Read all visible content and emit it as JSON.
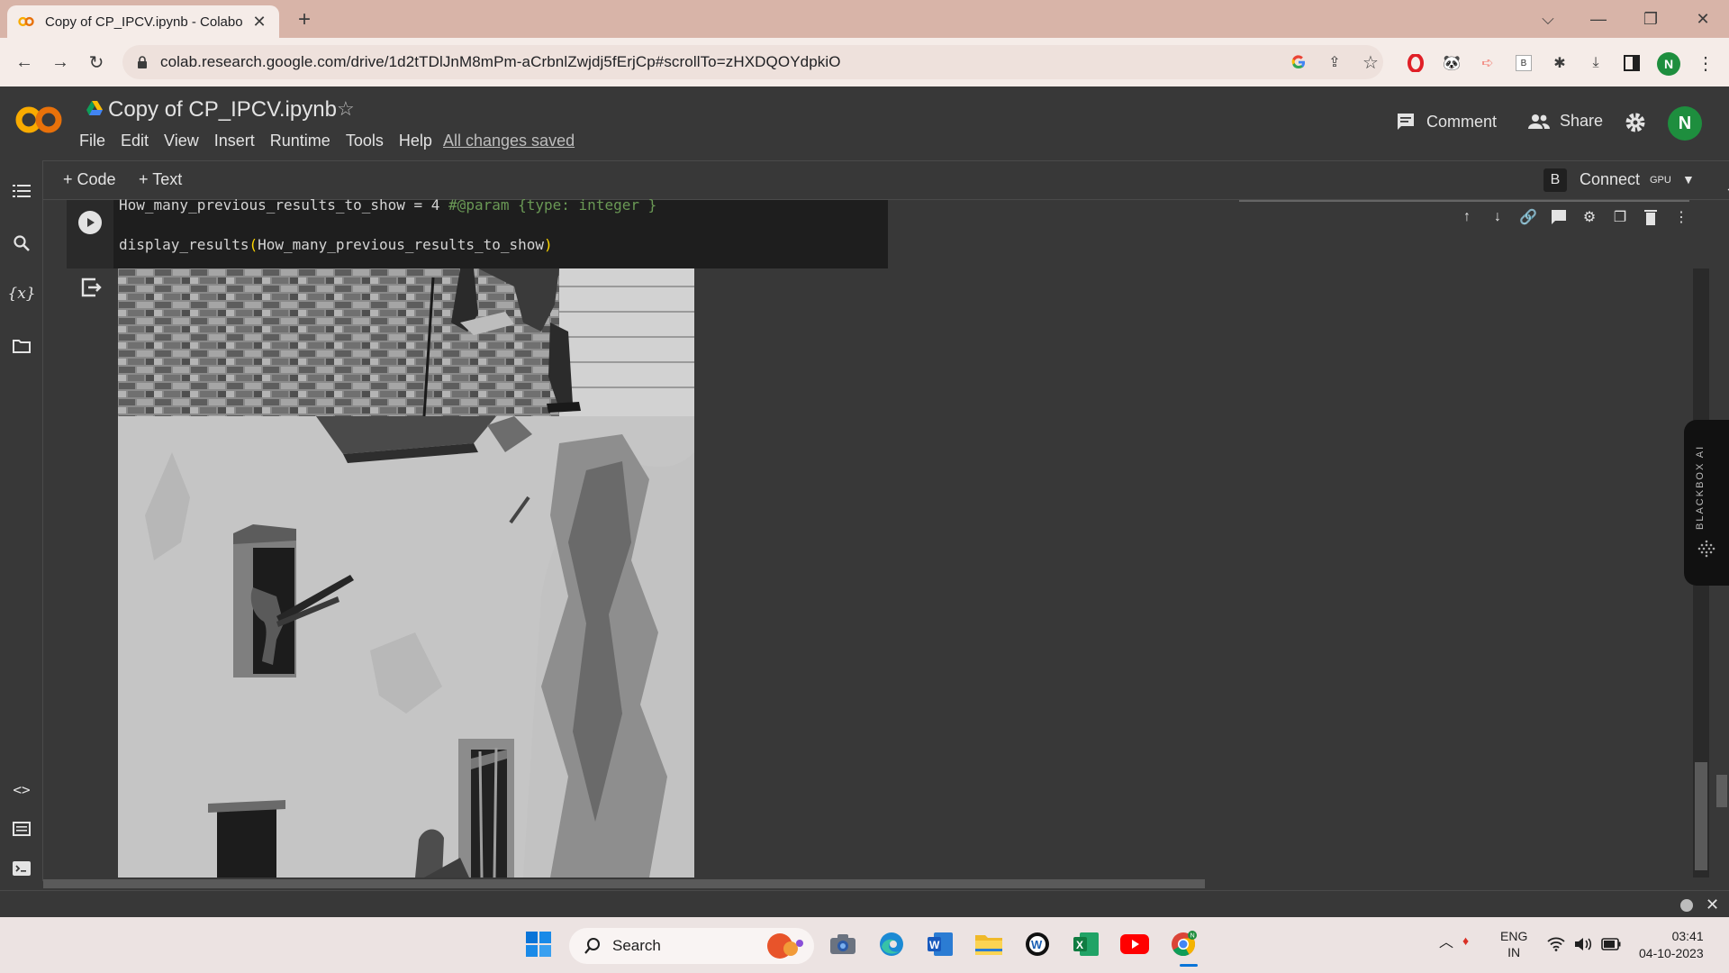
{
  "browser": {
    "tab_title": "Copy of CP_IPCV.ipynb - Colabo",
    "url": "colab.research.google.com/drive/1d2tTDlJnM8mPm-aCrbnlZwjdj5fErjCp#scrollTo=zHXDQOYdpkiO",
    "profile_initial": "N"
  },
  "colab": {
    "notebook_title": "Copy of CP_IPCV.ipynb",
    "menu": [
      "File",
      "Edit",
      "View",
      "Insert",
      "Runtime",
      "Tools",
      "Help"
    ],
    "save_status": "All changes saved",
    "comment_label": "Comment",
    "share_label": "Share",
    "user_initial": "N",
    "add_code_label": "+ Code",
    "add_text_label": "+ Text",
    "runtime_badge": "B",
    "connect_label": "Connect",
    "gpu_label": "GPU"
  },
  "cell": {
    "line1_code": "How_many_previous_results_to_show = 4 ",
    "line1_comment": "#@param {type: integer }",
    "line2_func": "display_results",
    "line2_open": "(",
    "line2_arg": "How_many_previous_results_to_show",
    "line2_close": ")"
  },
  "side_panel": {
    "label": "BLACKBOX AI"
  },
  "taskbar": {
    "search_label": "Search",
    "lang_line1": "ENG",
    "lang_line2": "IN",
    "time": "03:41",
    "date": "04-10-2023"
  },
  "colors": {
    "colab_bg": "#383838",
    "code_bg": "#1e1e1e",
    "comment_green": "#6a9955",
    "avatar_green": "#1e8e3e",
    "tabbar": "#d8b4a8"
  }
}
